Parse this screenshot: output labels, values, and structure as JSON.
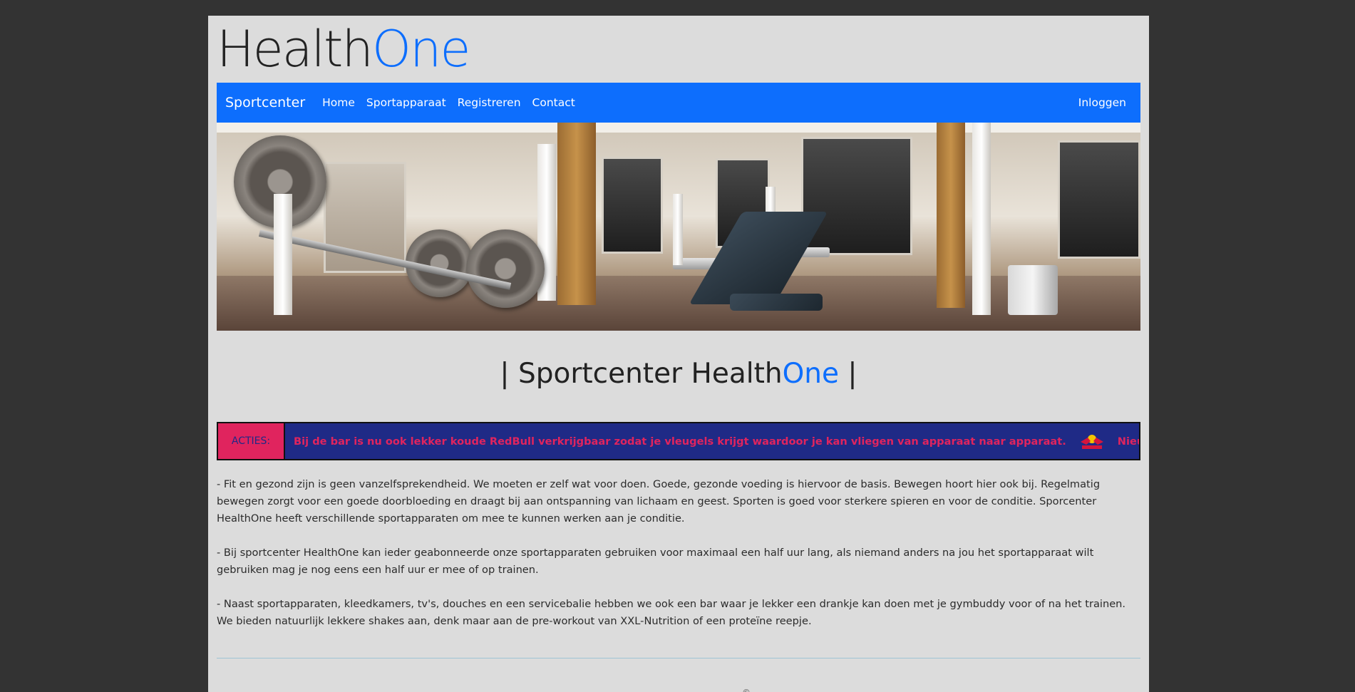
{
  "logo": {
    "part1": "Health",
    "part2": "One"
  },
  "nav": {
    "brand": "Sportcenter",
    "links": [
      "Home",
      "Sportapparaat",
      "Registreren",
      "Contact"
    ],
    "login": "Inloggen"
  },
  "hero": {
    "alt": "gym-interior-photo"
  },
  "title": {
    "prefix": "| Sportcenter Health",
    "accent": "One",
    "suffix": " |"
  },
  "ticker": {
    "label": "ACTIES:",
    "items": [
      "Bij de bar is nu ook lekker koude RedBull verkrijgbaar zodat je vleugels krijgt waardoor je kan vliegen van apparaat naar apparaat.",
      "Nieuwe smaak van"
    ],
    "logo_icon": "redbull-logo-icon"
  },
  "paragraphs": [
    "- Fit en gezond zijn is geen vanzelfsprekendheid. We moeten er zelf wat voor doen. Goede, gezonde voeding is hiervoor de basis. Bewegen hoort hier ook bij. Regelmatig bewegen zorgt voor een goede doorbloeding en draagt bij aan ontspanning van lichaam en geest. Sporten is goed voor sterkere spieren en voor de conditie. Sporcenter HealthOne heeft verschillende sportapparaten om mee te kunnen werken aan je conditie.",
    "- Bij sportcenter HealthOne kan ieder geabonneerde onze sportapparaten gebruiken voor maximaal een half uur lang, als niemand anders na jou het sportapparaat wilt gebruiken mag je nog eens een half uur er mee of op trainen.",
    "- Naast sportapparaten, kleedkamers, tv's, douches en een servicebalie hebben we ook een bar waar je lekker een drankje kan doen met je gymbuddy voor of na het trainen. We bieden natuurlijk lekkere shakes aan, denk maar aan de pre-workout van XXL-Nutrition of een proteïne reepje."
  ],
  "footer": {
    "mark": "©"
  },
  "colors": {
    "accent": "#0d6efd",
    "ticker_bg": "#1f2a86",
    "ticker_text": "#e0245e",
    "page_bg": "#dcdcdc",
    "outer_bg": "#333333"
  }
}
